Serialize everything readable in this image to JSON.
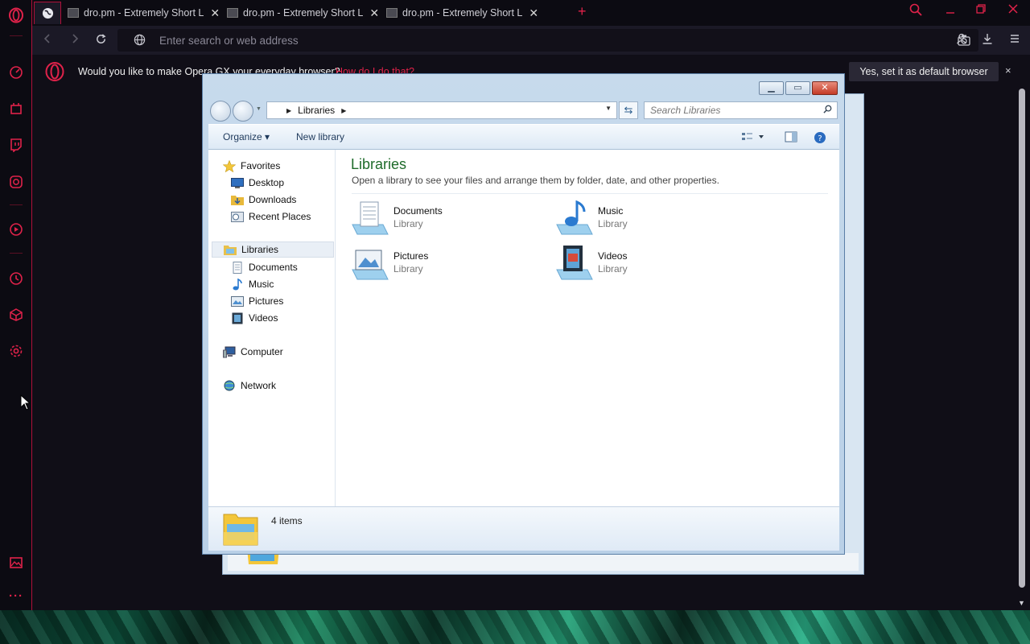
{
  "browser": {
    "tabs": [
      {
        "title": "dro.pm - Extremely Short L",
        "close": "✕"
      },
      {
        "title": "dro.pm - Extremely Short L",
        "close": "✕"
      },
      {
        "title": "dro.pm - Extremely Short L",
        "close": "✕"
      }
    ],
    "new_tab": "+",
    "address_placeholder": "Enter search or web address",
    "infobar": {
      "message": "Would you like to make Opera GX your everyday browser?",
      "link": "How do I do that?",
      "default_button": "Yes, set it as default browser",
      "close": "×"
    },
    "accent": "#e0224a"
  },
  "explorer": {
    "breadcrumb": "Libraries",
    "search_placeholder": "Search Libraries",
    "toolbar": {
      "organize": "Organize ▾",
      "new_library": "New library"
    },
    "nav": {
      "favorites": "Favorites",
      "desktop": "Desktop",
      "downloads": "Downloads",
      "recent": "Recent Places",
      "libraries": "Libraries",
      "documents": "Documents",
      "music": "Music",
      "pictures": "Pictures",
      "videos": "Videos",
      "computer": "Computer",
      "network": "Network"
    },
    "main": {
      "title": "Libraries",
      "subtitle": "Open a library to see your files and arrange them by folder, date, and other properties.",
      "items": [
        {
          "name": "Documents",
          "type": "Library"
        },
        {
          "name": "Music",
          "type": "Library"
        },
        {
          "name": "Pictures",
          "type": "Library"
        },
        {
          "name": "Videos",
          "type": "Library"
        }
      ]
    },
    "status": "4 items"
  }
}
